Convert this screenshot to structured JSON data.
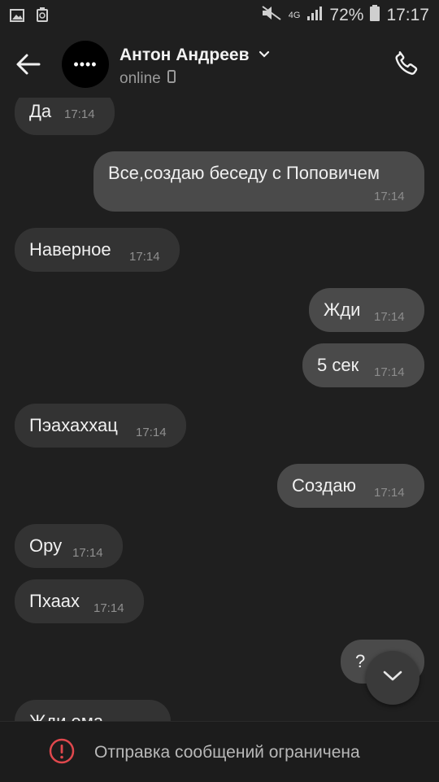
{
  "status_bar": {
    "network": "4G",
    "battery": "72%",
    "time": "17:17"
  },
  "header": {
    "contact_name": "Антон Андреев",
    "presence": "online",
    "avatar_text": "••••"
  },
  "messages": [
    {
      "text": "Да",
      "time": "17:14",
      "direction": "incoming"
    },
    {
      "text": "Все,создаю беседу с Поповичем",
      "time": "17:14",
      "direction": "outgoing"
    },
    {
      "text": "Наверное",
      "time": "17:14",
      "direction": "incoming"
    },
    {
      "text": "Жди",
      "time": "17:14",
      "direction": "outgoing"
    },
    {
      "text": "5 сек",
      "time": "17:14",
      "direction": "outgoing"
    },
    {
      "text": "Пэахаххац",
      "time": "17:14",
      "direction": "incoming"
    },
    {
      "text": "Создаю",
      "time": "17:14",
      "direction": "outgoing"
    },
    {
      "text": "Ору",
      "time": "17:14",
      "direction": "incoming"
    },
    {
      "text": "Пхаах",
      "time": "17:14",
      "direction": "incoming"
    },
    {
      "text": "?",
      "time": "",
      "direction": "outgoing"
    },
    {
      "text": "Жди ема",
      "time": "",
      "direction": "incoming"
    }
  ],
  "footer": {
    "notice": "Отправка сообщений ограничена"
  },
  "colors": {
    "background": "#1f1f1f",
    "incoming_bubble": "#333333",
    "outgoing_bubble": "#4a4a4a",
    "warning": "#e0484d"
  }
}
